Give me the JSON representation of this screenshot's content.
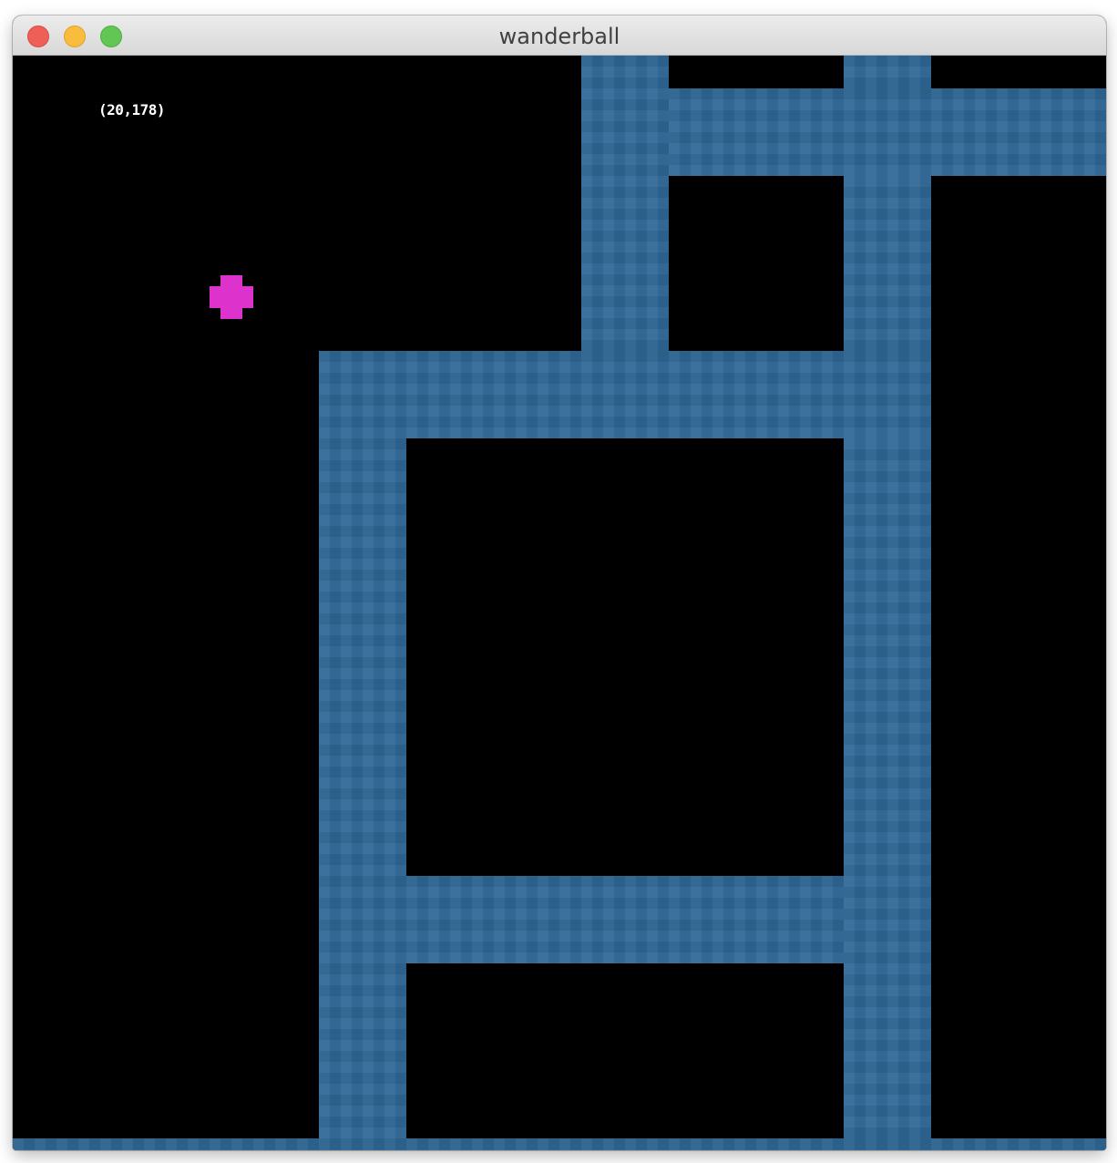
{
  "window": {
    "title": "wanderball",
    "buttons": [
      "close",
      "minimize",
      "zoom"
    ]
  },
  "game": {
    "position_readout": "(20,178)",
    "player": {
      "shape": "pixel-cross",
      "color": "#dd33cc"
    },
    "colors": {
      "background": "#000000",
      "wall": "#2f6796"
    }
  }
}
